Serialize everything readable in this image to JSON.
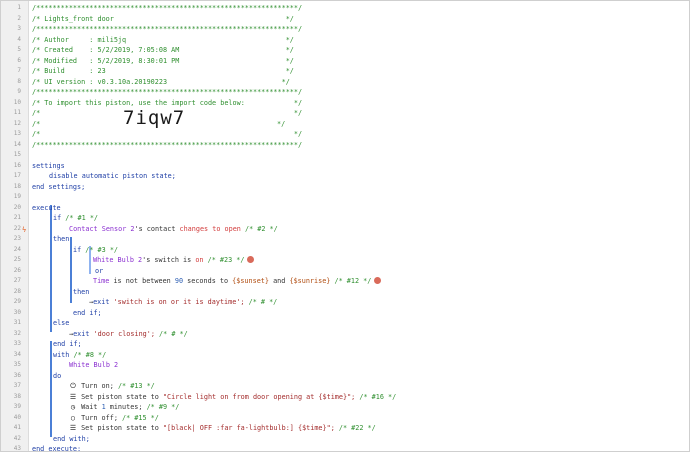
{
  "header": {
    "border": "/****************************************************************/",
    "name_line": "/* Lights_front door                                          */",
    "author_line": "/* Author     : mili5jq                                       */",
    "created_line": "/* Created    : 5/2/2019, 7:05:08 AM                          */",
    "modified_line": "/* Modified   : 5/2/2019, 8:30:01 PM                          */",
    "build_line": "/* Build      : 23                                            */",
    "uiversion_line": "/* UI version : v0.3.10a.20190223                            */",
    "import_line": "/* To import this piston, use the import code below:            */",
    "empty_line": "/*                                                              */",
    "import_code_left": "/*",
    "import_code_right": "*/",
    "import_code": "7iqw7"
  },
  "code": {
    "settings": "settings",
    "disable": "disable automatic piston state;",
    "end_settings": "end settings;",
    "execute": "execute",
    "if1": "if",
    "if1_c": "/* #1 */",
    "cond1_dev": "Contact Sensor 2",
    "cond1_a": "'s contact",
    "cond1_b": "changes to",
    "cond1_v": "open",
    "cond1_c": "/* #2 */",
    "then1": "then",
    "if2": "if",
    "if2_c": "/* #3 */",
    "cond2_dev": "White Bulb 2",
    "cond2_a": "'s switch",
    "cond2_b": "is",
    "cond2_v": "on",
    "cond2_c": "/* #23 */",
    "or": "or",
    "cond3_dev": "Time",
    "cond3_a": "is not between",
    "cond3_n": "90",
    "cond3_b": "seconds to",
    "cond3_v1": "{$sunset}",
    "cond3_and": "and",
    "cond3_v2": "{$sunrise}",
    "cond3_c": "/* #12 */",
    "then2": "then",
    "exit1": "exit",
    "exit1_s": "'switch is on or it is daytime';",
    "exit1_c": "/* # */",
    "endif2": "end if;",
    "else": "else",
    "exit2": "exit",
    "exit2_s": "'door closing';",
    "exit2_c": "/* # */",
    "endif1": "end if;",
    "with": "with",
    "with_c": "/* #8 */",
    "with_dev": "White Bulb 2",
    "do": "do",
    "turnon": "Turn on;",
    "turnon_c": "/* #13 */",
    "set1_a": "Set piston state to",
    "set1_s": "\"Circle light on from door opening at {$time}\";",
    "set1_c": "/* #16 */",
    "wait_a": "Wait",
    "wait_n": "1",
    "wait_b": "minutes;",
    "wait_c": "/* #9 */",
    "turnoff": "Turn off;",
    "turnoff_c": "/* #15 */",
    "set2_a": "Set piston state to",
    "set2_s": "\"[black| OFF :far fa-lightbulb:] {$time}\";",
    "set2_c": "/* #22 */",
    "endwith": "end with;",
    "endexecute": "end execute;"
  },
  "icons": {
    "trigger": "lightning-bolt-icon",
    "power": "power-icon",
    "list": "list-icon",
    "clock": "clock-icon",
    "circle": "circle-icon",
    "remove": "remove-icon"
  },
  "line_numbers": [
    "1",
    "2",
    "3",
    "4",
    "5",
    "6",
    "7",
    "8",
    "9",
    "10",
    "11",
    "12",
    "13",
    "14",
    "15",
    "16",
    "17",
    "18",
    "19",
    "20",
    "21",
    "22",
    "23",
    "24",
    "25",
    "26",
    "27",
    "28",
    "29",
    "30",
    "31",
    "32",
    "33",
    "34",
    "35",
    "36",
    "37",
    "38",
    "39",
    "40",
    "41",
    "42",
    "43"
  ]
}
